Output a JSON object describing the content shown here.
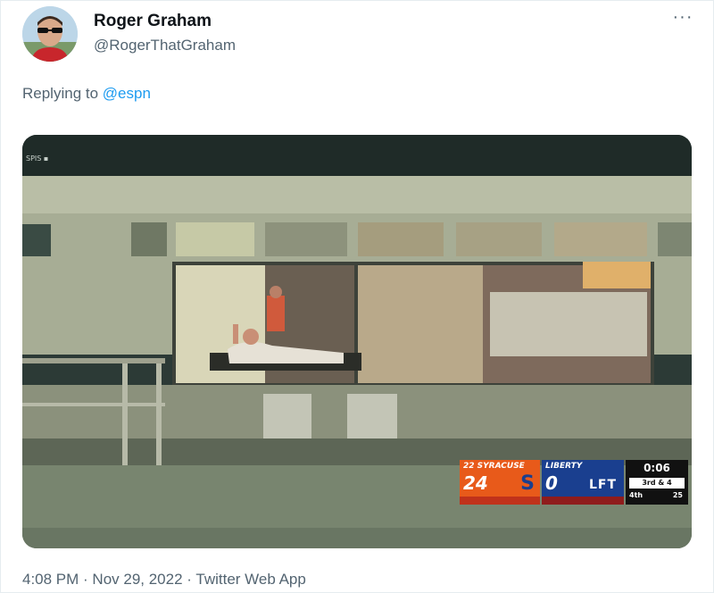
{
  "tweet": {
    "author": {
      "display_name": "Roger Graham",
      "handle": "@RogerThatGraham"
    },
    "more_icon": "more-horizontal-icon",
    "reply": {
      "prefix": "Replying to ",
      "mention": "@espn"
    },
    "timestamp": {
      "time": "4:08 PM",
      "sep1": " · ",
      "date": "Nov 29, 2022",
      "sep2": " · ",
      "source": "Twitter Web App"
    }
  },
  "scorebug": {
    "network": "SPIS ▪",
    "home": {
      "name": "22 SYRACUSE",
      "score": "24",
      "logo": "S",
      "color": "#e85a1a"
    },
    "away": {
      "name": "LIBERTY",
      "score": "0",
      "logo": "LFT",
      "color": "#1a3f8f"
    },
    "clock": "0:06",
    "down": "3rd & 4",
    "quarter": "4th",
    "play_clock": "25"
  }
}
